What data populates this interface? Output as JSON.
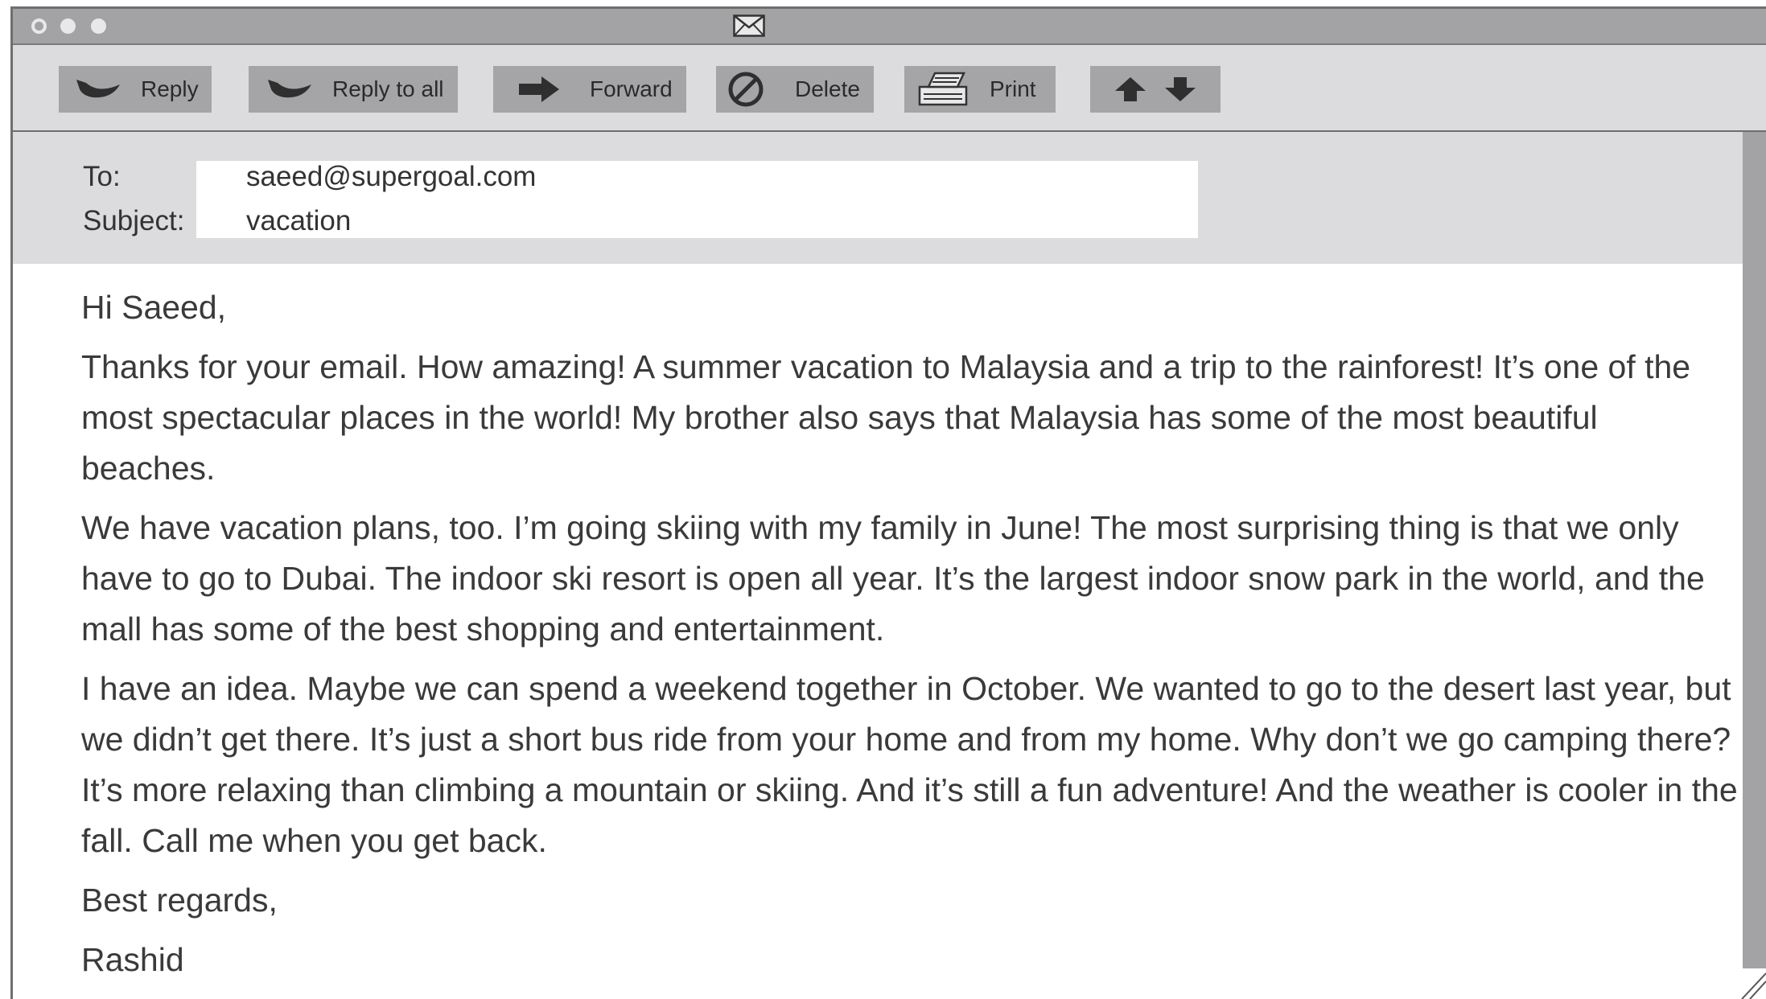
{
  "window": {
    "title_icon": "envelope-icon"
  },
  "toolbar": {
    "reply_label": "Reply",
    "reply_all_label": "Reply to all",
    "forward_label": "Forward",
    "delete_label": "Delete",
    "print_label": "Print"
  },
  "header": {
    "to_label": "To:",
    "to_value": "saeed@supergoal.com",
    "subject_label": "Subject:",
    "subject_value": "vacation"
  },
  "message": {
    "greeting": "Hi Saeed,",
    "paragraphs": [
      "Thanks for your email. How amazing! A summer vacation to Malaysia and a trip to the rainforest! It’s one of the most spectacular places in the world! My brother also says that Malaysia has some of the most beautiful beaches.",
      "We have vacation plans, too. I’m going skiing with my family in June! The most surprising thing is that we only have to go to Dubai. The indoor ski resort is open all year. It’s the largest indoor snow park in the world, and the mall has some of the best shopping and entertainment.",
      "I have an idea. Maybe we can spend a weekend together in October. We wanted to go to the desert last year, but we didn’t get there. It’s just a short bus ride from your home and from my home. Why don’t we go camping there? It’s more relaxing than climbing a mountain or skiing. And it’s still a fun adventure! And the weather is cooler in the fall. Call me when you get back."
    ],
    "closing": "Best regards,",
    "signature": "Rashid"
  }
}
